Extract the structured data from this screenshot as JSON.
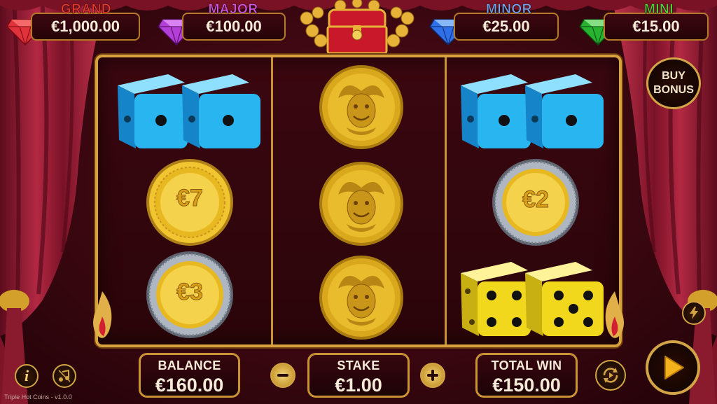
{
  "jackpots": [
    {
      "label": "GRAND",
      "value": "€1,000.00",
      "label_color": "#e9382c",
      "gem": "red-gem-icon",
      "gem_color": "#e0323a"
    },
    {
      "label": "MAJOR",
      "value": "€100.00",
      "label_color": "#d357e8",
      "gem": "purple-gem-icon",
      "gem_color": "#b43fd6"
    },
    {
      "label": "MINOR",
      "value": "€25.00",
      "label_color": "#72a6f2",
      "gem": "blue-gem-icon",
      "gem_color": "#2f6fe8"
    },
    {
      "label": "MINI",
      "value": "€15.00",
      "label_color": "#4ed43c",
      "gem": "green-gem-icon",
      "gem_color": "#27b330"
    }
  ],
  "buy_bonus": {
    "line1": "BUY",
    "line2": "BONUS"
  },
  "reels": [
    [
      "blue-dice",
      "coin-7",
      "coin-3"
    ],
    [
      "jester-coin",
      "jester-coin",
      "jester-coin"
    ],
    [
      "blue-dice",
      "coin-2",
      "yellow-dice"
    ]
  ],
  "coins": {
    "coin-7": {
      "text": "€7",
      "rim": "gold"
    },
    "coin-3": {
      "text": "€3",
      "rim": "silver"
    },
    "coin-2": {
      "text": "€2",
      "rim": "silver"
    }
  },
  "bottom": {
    "balance_label": "BALANCE",
    "balance_value": "€160.00",
    "stake_label": "STAKE",
    "stake_value": "€1.00",
    "total_win_label": "TOTAL WIN",
    "total_win_value": "€150.00"
  },
  "version_text": "Triple Hot Coins - v1.0.0",
  "colors": {
    "frame_gold": "#d7a13e",
    "reel_bg": "#3b0710",
    "curtain": "#a0203a",
    "coin_gold": "#e0b020",
    "dice_blue": "#29b6f0",
    "dice_yellow": "#f2d81c"
  }
}
